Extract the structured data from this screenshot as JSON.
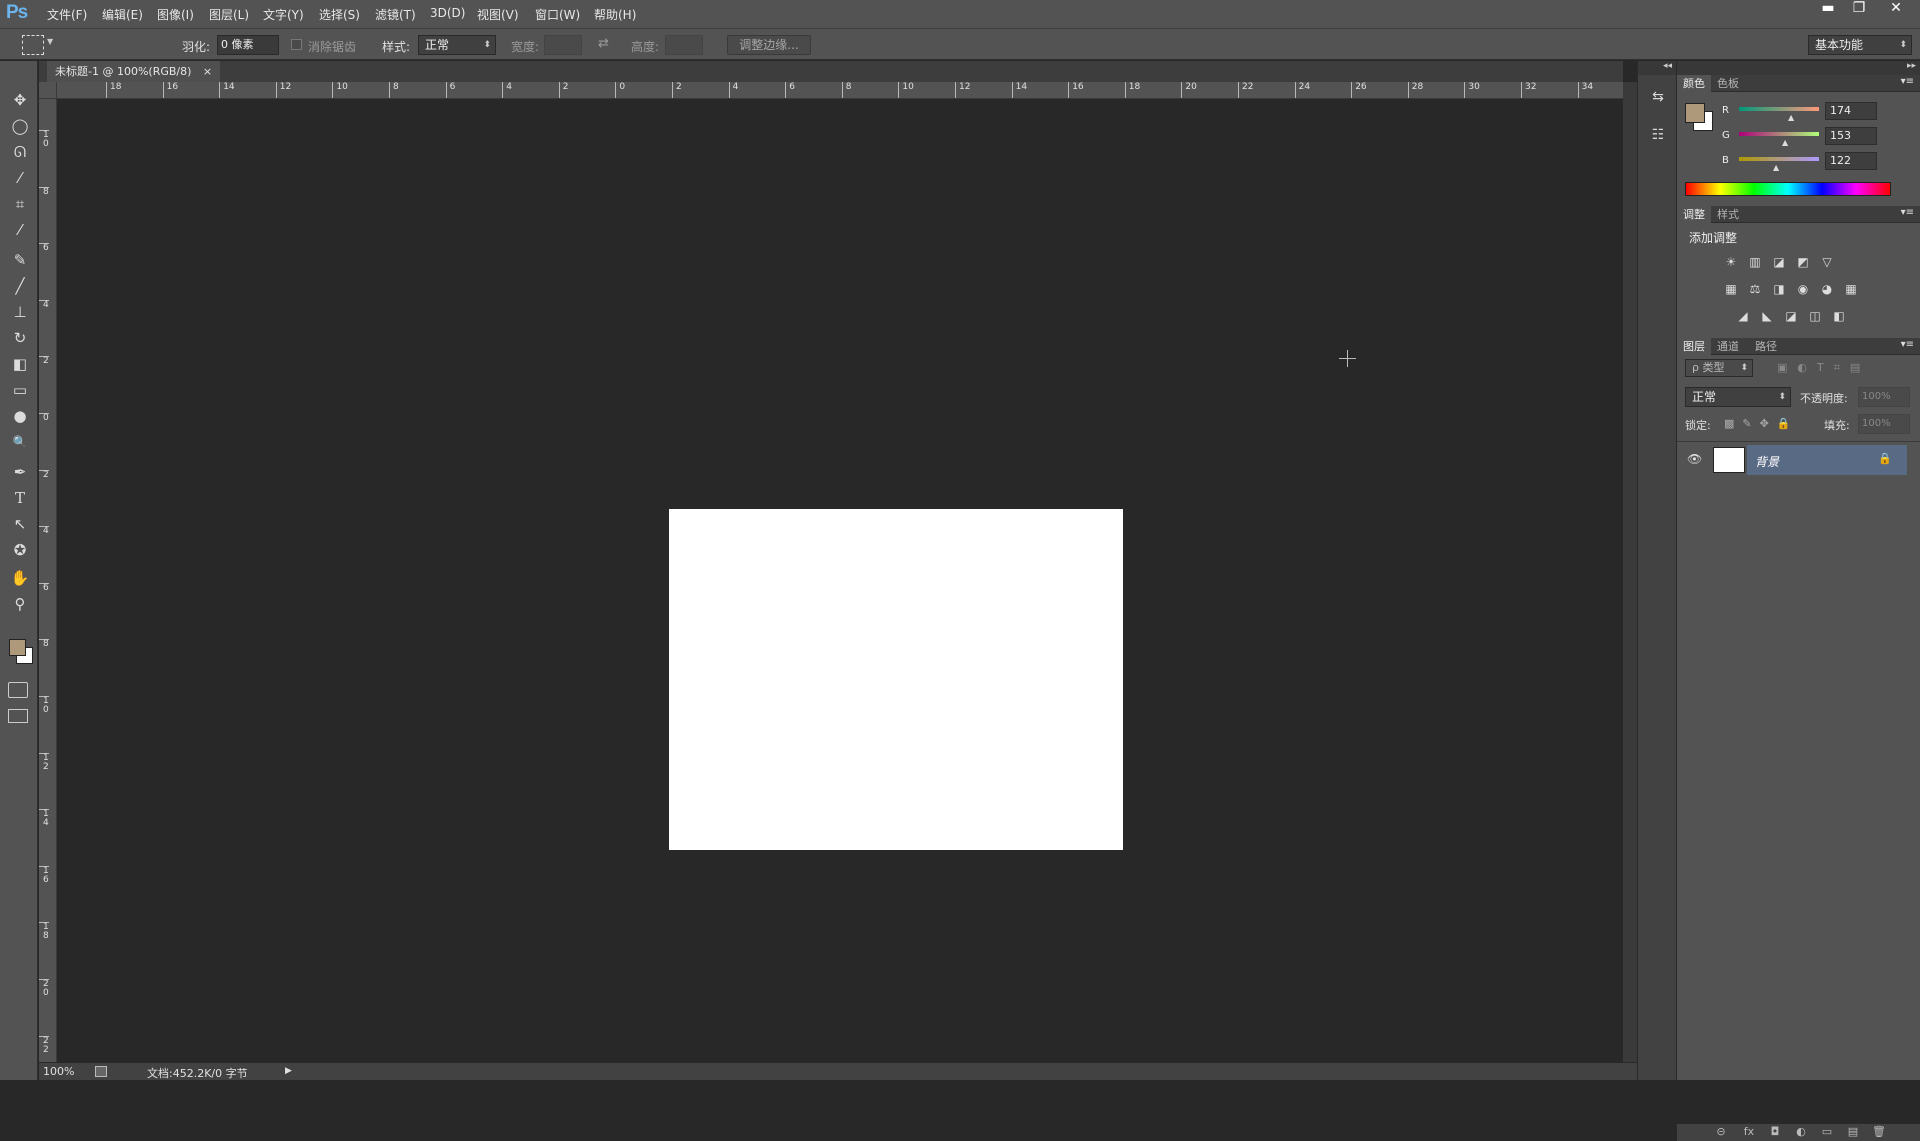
{
  "app": {
    "logo": "Ps"
  },
  "menu": [
    "文件(F)",
    "编辑(E)",
    "图像(I)",
    "图层(L)",
    "文字(Y)",
    "选择(S)",
    "滤镜(T)",
    "3D(D)",
    "视图(V)",
    "窗口(W)",
    "帮助(H)"
  ],
  "window_controls": {
    "minimize": "▬",
    "restore": "❐",
    "close": "✕"
  },
  "options": {
    "feather_label": "羽化:",
    "feather_value": "0 像素",
    "antialias_label": "消除锯齿",
    "style_label": "样式:",
    "style_value": "正常",
    "width_label": "宽度:",
    "height_label": "高度:",
    "swap_icon": "⇄",
    "refine_edge": "调整边缘...",
    "workspace": "基本功能"
  },
  "tools": [
    "move-tool",
    "marquee-tool",
    "lasso-tool",
    "quick-select-tool",
    "crop-tool",
    "eyedropper-tool",
    "healing-brush-tool",
    "brush-tool",
    "clone-stamp-tool",
    "history-brush-tool",
    "eraser-tool",
    "gradient-tool",
    "blur-tool",
    "dodge-tool",
    "pen-tool",
    "type-tool",
    "path-select-tool",
    "shape-tool",
    "hand-tool",
    "zoom-tool"
  ],
  "tool_glyphs": [
    "✥",
    "◯",
    "ᘏ",
    "⁄",
    "⌗",
    "⁄",
    "✎",
    "╱",
    "⊥",
    "↻",
    "◧",
    "▭",
    "●",
    "🔍",
    "✒",
    "T",
    "↖",
    "✪",
    "✋",
    "⚲"
  ],
  "document": {
    "tab_title": "未标题-1 @ 100%(RGB/8)",
    "tab_close": "×",
    "zoom": "100%",
    "doc_info": "文档:452.2K/0 字节",
    "arrow": "▶"
  },
  "ruler": {
    "h_labels": [
      "18",
      "16",
      "14",
      "12",
      "10",
      "8",
      "6",
      "4",
      "2",
      "0",
      "2",
      "4",
      "6",
      "8",
      "10",
      "12",
      "14",
      "16",
      "18",
      "20",
      "22",
      "24",
      "26",
      "28",
      "30",
      "32",
      "34"
    ],
    "v_labels": [
      "10",
      "8",
      "6",
      "4",
      "2",
      "0",
      "2",
      "4",
      "6",
      "8",
      "10",
      "12",
      "14",
      "16",
      "18",
      "20",
      "22"
    ]
  },
  "color_panel": {
    "tabs": [
      "颜色",
      "色板"
    ],
    "r_label": "R",
    "g_label": "G",
    "b_label": "B",
    "r": "174",
    "g": "153",
    "b": "122",
    "foreground": "#ae997a",
    "background": "#ffffff"
  },
  "adjust_panel": {
    "tabs": [
      "调整",
      "样式"
    ],
    "title": "添加调整",
    "row1": [
      "☀",
      "▥",
      "◪",
      "◩",
      "▽"
    ],
    "row2": [
      "▦",
      "⚖",
      "◨",
      "◉",
      "◕",
      "▦"
    ],
    "row3": [
      "◢",
      "◣",
      "◪",
      "◫",
      "◧"
    ]
  },
  "layers_panel": {
    "tabs": [
      "图层",
      "通道",
      "路径"
    ],
    "filter": "ρ 类型",
    "blend": "正常",
    "opacity_label": "不透明度:",
    "opacity": "100%",
    "lock_label": "锁定:",
    "fill_label": "填充:",
    "fill": "100%",
    "layer_name": "背景",
    "bottom_icons": [
      "⊝",
      "fx",
      "◘",
      "◐",
      "▭",
      "▤",
      "🗑"
    ]
  },
  "panel_menu": "▾≡",
  "midstrip": [
    "⇆",
    "☷"
  ]
}
